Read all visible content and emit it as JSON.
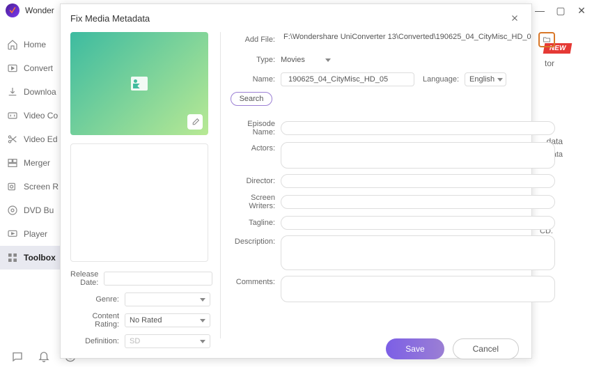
{
  "app": {
    "title": "Wonder"
  },
  "sidebar": {
    "items": [
      {
        "label": "Home"
      },
      {
        "label": "Convert"
      },
      {
        "label": "Downloa"
      },
      {
        "label": "Video Co"
      },
      {
        "label": "Video Ed"
      },
      {
        "label": "Merger"
      },
      {
        "label": "Screen R"
      },
      {
        "label": "DVD Bu"
      },
      {
        "label": "Player"
      },
      {
        "label": "Toolbox"
      }
    ]
  },
  "badge": {
    "text": "NEW"
  },
  "background": {
    "text1": "tor",
    "text2": "data",
    "text3": "etadata",
    "text4": "CD."
  },
  "modal": {
    "title": "Fix Media Metadata",
    "addFileLabel": "Add File:",
    "addFileValue": "F:\\Wondershare UniConverter 13\\Converted\\190625_04_CityMisc_HD_0",
    "typeLabel": "Type:",
    "typeValue": "Movies",
    "nameLabel": "Name:",
    "nameValue": "190625_04_CityMisc_HD_05",
    "languageLabel": "Language:",
    "languageValue": "English",
    "searchLabel": "Search",
    "left": {
      "releaseDateLabel": "Release Date:",
      "releaseDateValue": "",
      "genreLabel": "Genre:",
      "genreValue": "",
      "contentRatingLabel": "Content Rating:",
      "contentRatingValue": "No Rated",
      "definitionLabel": "Definition:",
      "definitionValue": "SD"
    },
    "right": {
      "episodeNameLabel": "Episode Name:",
      "actorsLabel": "Actors:",
      "directorLabel": "Director:",
      "screenWritersLabel": "Screen Writers:",
      "taglineLabel": "Tagline:",
      "descriptionLabel": "Description:",
      "commentsLabel": "Comments:"
    },
    "saveLabel": "Save",
    "cancelLabel": "Cancel"
  }
}
